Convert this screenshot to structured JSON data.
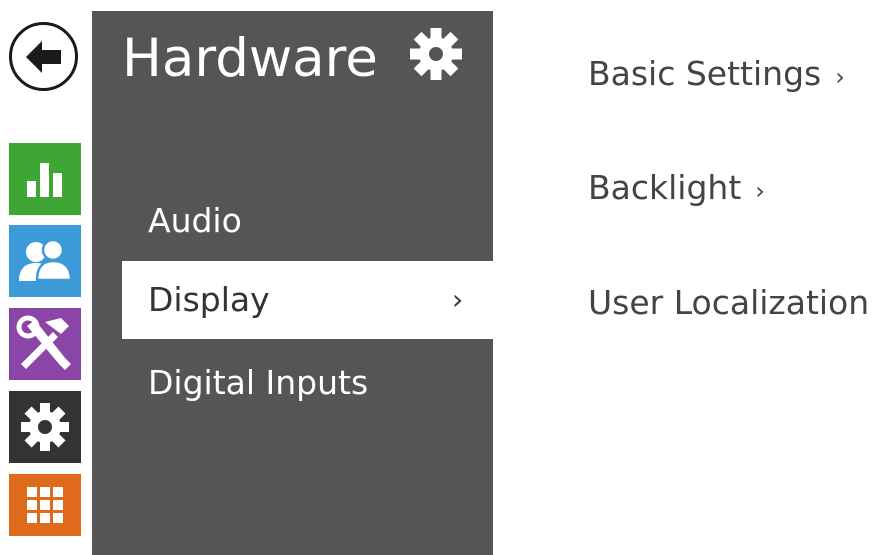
{
  "sidebar": {
    "back_icon": "arrow-left-icon",
    "tiles": [
      {
        "name": "status",
        "icon": "bar-chart-icon",
        "color": "#3fa535"
      },
      {
        "name": "directory",
        "icon": "users-icon",
        "color": "#3d9ad8"
      },
      {
        "name": "services",
        "icon": "hammer-wrench-icon",
        "color": "#8a45a6"
      },
      {
        "name": "hardware",
        "icon": "gear-icon",
        "color": "#333333"
      },
      {
        "name": "system",
        "icon": "grid-icon",
        "color": "#e06a1b"
      }
    ]
  },
  "panel": {
    "title": "Hardware",
    "title_icon": "gear-icon",
    "background": "#555555",
    "items": [
      {
        "label": "Audio",
        "active": false
      },
      {
        "label": "Display",
        "active": true,
        "chevron": "›"
      },
      {
        "label": "Digital Inputs",
        "active": false
      }
    ]
  },
  "submenu": {
    "items": [
      {
        "label": "Basic Settings",
        "chevron": "›"
      },
      {
        "label": "Backlight",
        "chevron": "›"
      },
      {
        "label": "User Localization",
        "chevron": "›"
      }
    ]
  }
}
